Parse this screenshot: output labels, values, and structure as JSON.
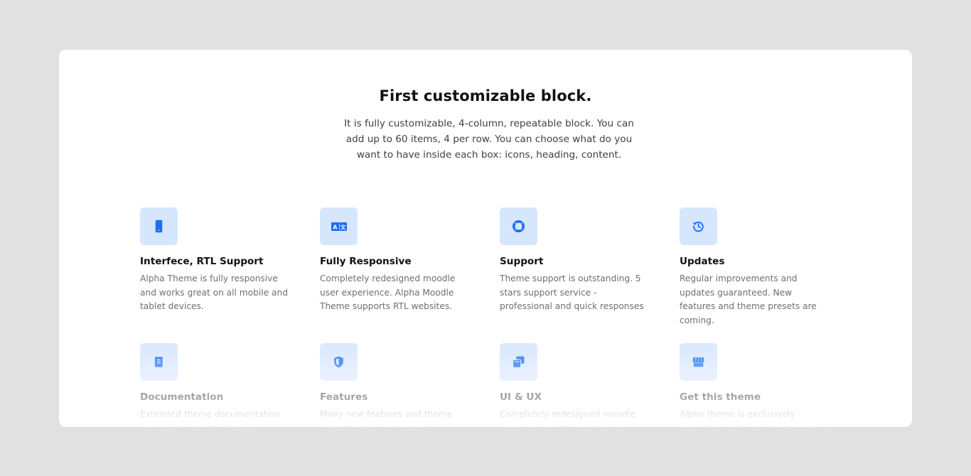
{
  "section": {
    "title": "First customizable block.",
    "subtitle": "It is fully customizable, 4-column, repeatable block. You can add up to 60 items, 4 per row. You can choose what do you want to have inside each box: icons, heading, content."
  },
  "features": [
    {
      "icon": "mobile-icon",
      "title": "Interfece, RTL Support",
      "text": "Alpha Theme is fully responsive and works great on all mobile and tablet devices."
    },
    {
      "icon": "translate-icon",
      "title": "Fully Responsive",
      "text": "Completely redesigned moodle user experience. Alpha Moodle Theme supports RTL websites."
    },
    {
      "icon": "lifebuoy-icon",
      "title": "Support",
      "text": "Theme support is outstanding. 5 stars support service - professional and quick responses"
    },
    {
      "icon": "history-icon",
      "title": "Updates",
      "text": "Regular improvements and updates guaranteed. New features and theme presets are coming."
    },
    {
      "icon": "book-icon",
      "title": "Documentation",
      "text": "Extended theme documentation is available online. Moodle"
    },
    {
      "icon": "shield-icon",
      "title": "Features",
      "text": "Many new features and theme customization options. Your website"
    },
    {
      "icon": "windows-icon",
      "title": "UI & UX",
      "text": "Completely redesigned moodle user experience, which is clean and"
    },
    {
      "icon": "store-icon",
      "title": "Get this theme",
      "text": "Alpha theme is exclusively available on Theme Forest market"
    }
  ],
  "colors": {
    "accent": "#1a6ff2",
    "icon_bg": "#d6e6fd",
    "page_bg": "#e1e1e1",
    "card_bg": "#ffffff"
  }
}
